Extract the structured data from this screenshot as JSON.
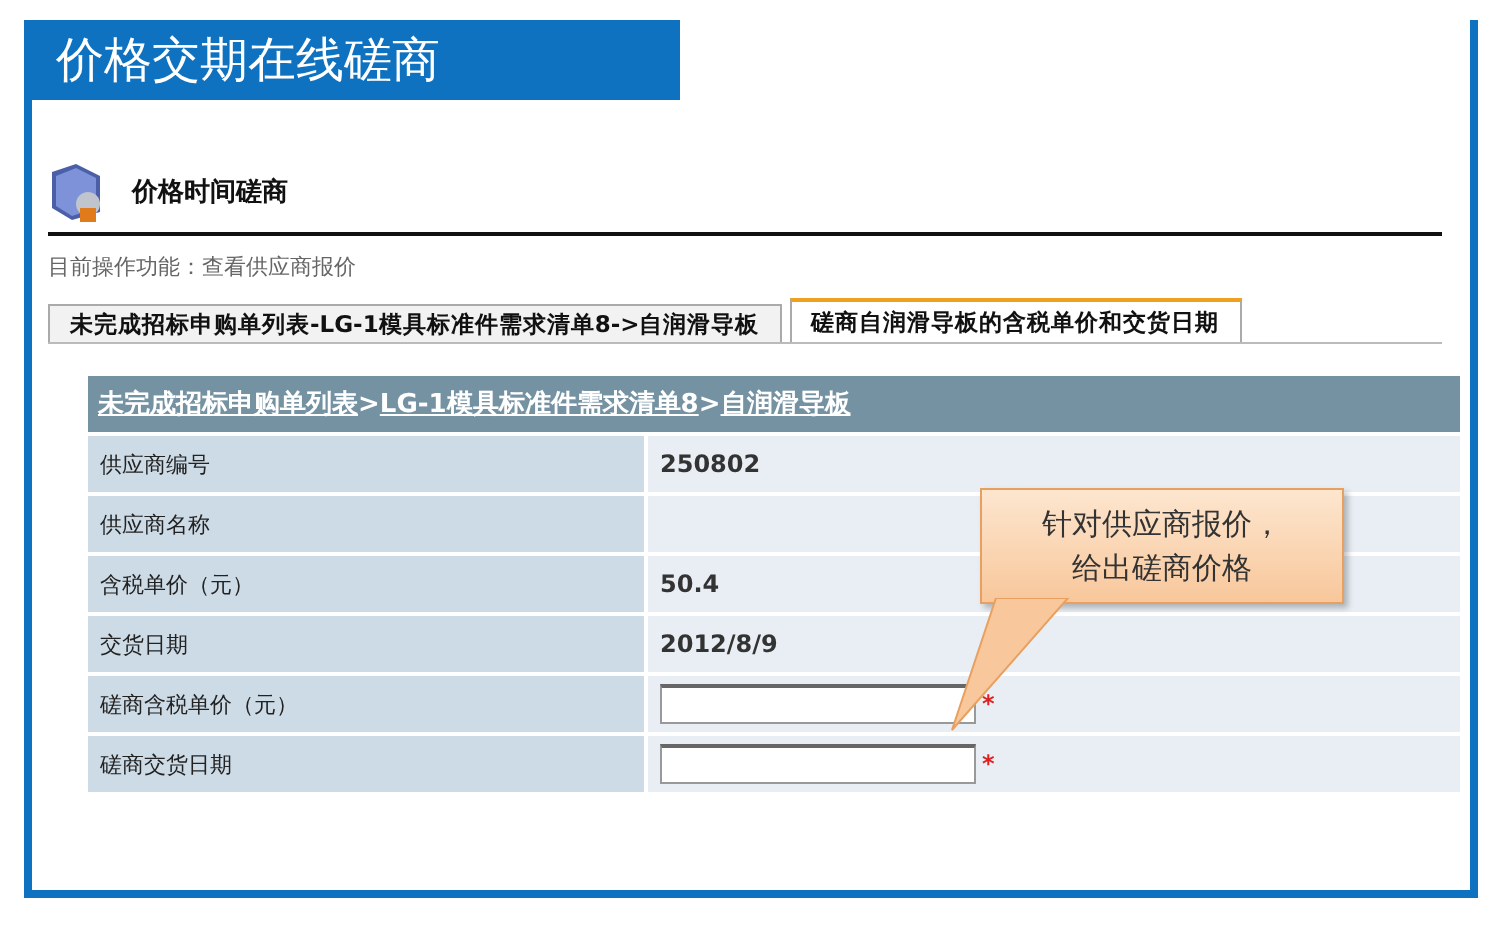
{
  "slide_title": "价格交期在线磋商",
  "page": {
    "title": "价格时间磋商",
    "subtitle": "目前操作功能：查看供应商报价"
  },
  "tabs": [
    {
      "label": "未完成招标申购单列表-LG-1模具标准件需求清单8->自润滑导板",
      "selected": false
    },
    {
      "label": "磋商自润滑导板的含税单价和交货日期",
      "selected": true
    }
  ],
  "breadcrumb": {
    "links": [
      "未完成招标申购单列表",
      "LG-1模具标准件需求清单8",
      "自润滑导板"
    ],
    "separator": ">"
  },
  "rows": [
    {
      "kind": "text",
      "label": "供应商编号",
      "value": "250802"
    },
    {
      "kind": "text",
      "label": "供应商名称",
      "value": ""
    },
    {
      "kind": "text",
      "label": "含税单价（元）",
      "value": "50.4"
    },
    {
      "kind": "text",
      "label": "交货日期",
      "value": "2012/8/9"
    },
    {
      "kind": "input",
      "label": "磋商含税单价（元）",
      "required_mark": "*"
    },
    {
      "kind": "input",
      "label": "磋商交货日期",
      "required_mark": "*"
    }
  ],
  "callout": {
    "lines": [
      "针对供应商报价，",
      "给出磋商价格"
    ]
  }
}
